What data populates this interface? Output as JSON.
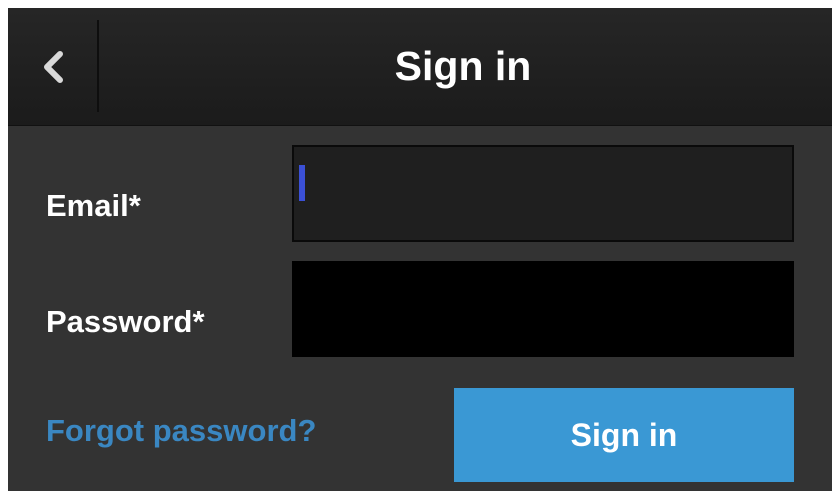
{
  "header": {
    "back_icon": "chevron-left-icon",
    "title": "Sign in"
  },
  "form": {
    "email_label": "Email*",
    "email_value": "",
    "password_label": "Password*",
    "password_value": ""
  },
  "actions": {
    "forgot_password": "Forgot password?",
    "sign_in": "Sign in"
  },
  "colors": {
    "accent": "#3a98d4",
    "link": "#3a87c2",
    "cursor": "#3b50d6",
    "background": "#333333",
    "header": "#1f1f1f"
  }
}
